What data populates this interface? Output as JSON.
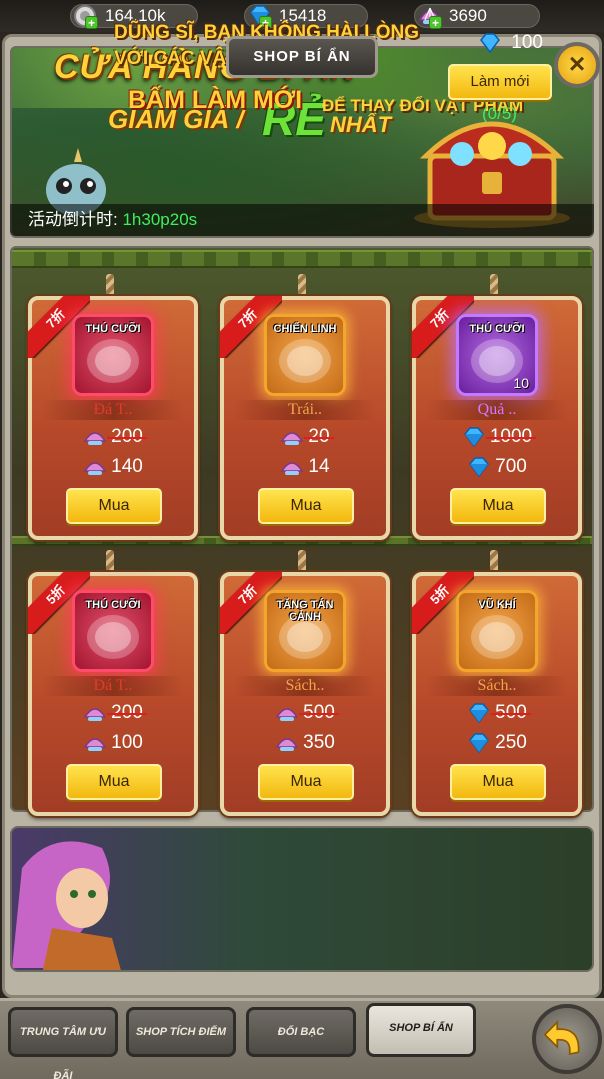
{
  "currencies": [
    {
      "name": "silver",
      "icon": "silver-coin-icon",
      "value": "164.10k"
    },
    {
      "name": "diamond",
      "icon": "blue-diamond-icon",
      "value": "15418"
    },
    {
      "name": "shell",
      "icon": "shell-gem-icon",
      "value": "3690"
    }
  ],
  "header": {
    "title": "SHOP BÍ ẨN",
    "close": "×"
  },
  "banner": {
    "line1": "CỬA HÀNG BÍ ẨN",
    "line2a": "GIẢM GIÁ /",
    "line2b": "RẺ",
    "line2c": "NHẤT"
  },
  "countdown": {
    "label": "活动倒计时:",
    "time": "1h30p20s"
  },
  "items": [
    {
      "discount": "7折",
      "tag": "THÚ CƯỠI",
      "qty": "",
      "name": "Đá T..",
      "name_color": "#e23a2a",
      "old_price": "200",
      "price": "140",
      "currency": "shell",
      "icon_style": "red"
    },
    {
      "discount": "7折",
      "tag": "CHIẾN LINH",
      "qty": "",
      "name": "Trái..",
      "name_color": "#f2a64a",
      "old_price": "20",
      "price": "14",
      "currency": "shell",
      "icon_style": "orange"
    },
    {
      "discount": "7折",
      "tag": "THÚ CƯỠI",
      "qty": "10",
      "name": "Quả ..",
      "name_color": "#d07bff",
      "old_price": "1000",
      "price": "700",
      "currency": "diamond",
      "icon_style": "purple"
    },
    {
      "discount": "5折",
      "tag": "THÚ CƯỠI",
      "qty": "",
      "name": "Đá T..",
      "name_color": "#e23a2a",
      "old_price": "200",
      "price": "100",
      "currency": "shell",
      "icon_style": "red"
    },
    {
      "discount": "7折",
      "tag": "TĂNG TÁN CẢNH",
      "qty": "",
      "name": "Sách..",
      "name_color": "#f2a64a",
      "old_price": "500",
      "price": "350",
      "currency": "shell",
      "icon_style": "orange"
    },
    {
      "discount": "5折",
      "tag": "VŨ KHÍ",
      "qty": "",
      "name": "Sách..",
      "name_color": "#f2a64a",
      "old_price": "500",
      "price": "250",
      "currency": "diamond",
      "icon_style": "orange"
    }
  ],
  "buy_label": "Mua",
  "refresh": {
    "line1": "DŨNG SĨ, BẠN KHÔNG HÀI LÒNG",
    "line2": "VỚI CÁC VẬT PHẨM TRÊN?",
    "big": "BẤM LÀM MỚI",
    "small": "ĐỂ THAY ĐỔI VẬT PHẨM",
    "cost": "100",
    "button": "Làm mới",
    "count": "(0/5)"
  },
  "tabs": [
    {
      "label": "TRUNG TÂM ƯU ĐÃI",
      "active": false
    },
    {
      "label": "SHOP TÍCH ĐIỂM",
      "active": false
    },
    {
      "label": "ĐỔI BẠC",
      "active": false
    },
    {
      "label": "SHOP BÍ ẨN",
      "active": true
    }
  ],
  "colors": {
    "accent_gold": "#ffd23a",
    "green_text": "#3df05a",
    "discount_red": "#d81c1c",
    "button_yellow": "#f3b80f"
  }
}
